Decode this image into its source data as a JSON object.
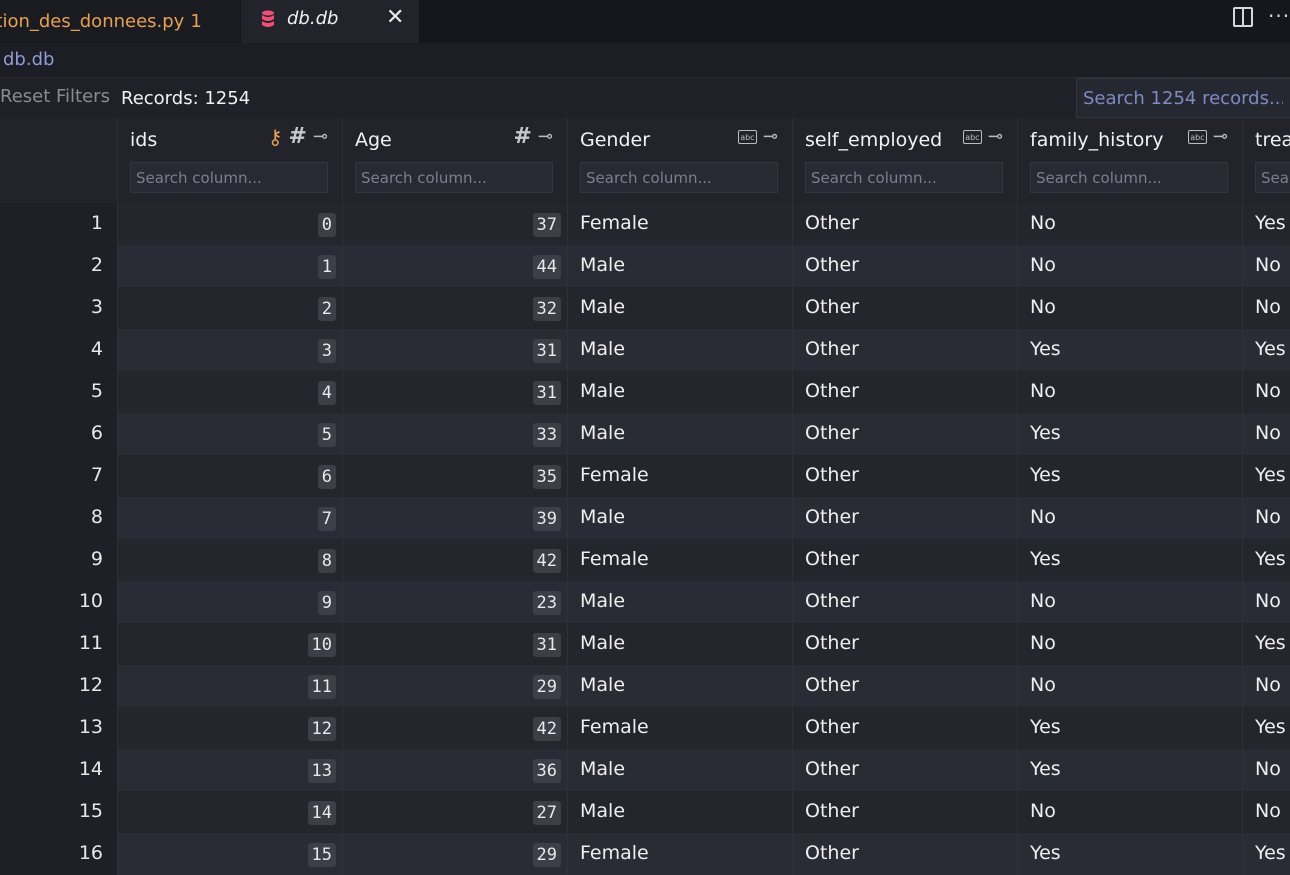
{
  "tabs": [
    {
      "label": "rtion_des_donnees.py",
      "badge": "1"
    },
    {
      "label": "db.db",
      "icon": "database-icon"
    }
  ],
  "breadcrumb": "db.db",
  "toolbar": {
    "reset_label": "Reset Filters",
    "records_label": "Records: 1254",
    "search_placeholder": "Search 1254 records..."
  },
  "columns": [
    {
      "name": "ids",
      "type": "integer",
      "primary_key": true,
      "placeholder": "Search column..."
    },
    {
      "name": "Age",
      "type": "integer",
      "placeholder": "Search column..."
    },
    {
      "name": "Gender",
      "type": "text",
      "placeholder": "Search column..."
    },
    {
      "name": "self_employed",
      "type": "text",
      "placeholder": "Search column..."
    },
    {
      "name": "family_history",
      "type": "text",
      "placeholder": "Search column..."
    },
    {
      "name": "treat",
      "type": "text",
      "placeholder": "Sear"
    }
  ],
  "rows": [
    {
      "n": "1",
      "ids": "0",
      "age": "37",
      "gender": "Female",
      "self_employed": "Other",
      "family_history": "No",
      "treat": "Yes"
    },
    {
      "n": "2",
      "ids": "1",
      "age": "44",
      "gender": "Male",
      "self_employed": "Other",
      "family_history": "No",
      "treat": "No"
    },
    {
      "n": "3",
      "ids": "2",
      "age": "32",
      "gender": "Male",
      "self_employed": "Other",
      "family_history": "No",
      "treat": "No"
    },
    {
      "n": "4",
      "ids": "3",
      "age": "31",
      "gender": "Male",
      "self_employed": "Other",
      "family_history": "Yes",
      "treat": "Yes"
    },
    {
      "n": "5",
      "ids": "4",
      "age": "31",
      "gender": "Male",
      "self_employed": "Other",
      "family_history": "No",
      "treat": "No"
    },
    {
      "n": "6",
      "ids": "5",
      "age": "33",
      "gender": "Male",
      "self_employed": "Other",
      "family_history": "Yes",
      "treat": "No"
    },
    {
      "n": "7",
      "ids": "6",
      "age": "35",
      "gender": "Female",
      "self_employed": "Other",
      "family_history": "Yes",
      "treat": "Yes"
    },
    {
      "n": "8",
      "ids": "7",
      "age": "39",
      "gender": "Male",
      "self_employed": "Other",
      "family_history": "No",
      "treat": "No"
    },
    {
      "n": "9",
      "ids": "8",
      "age": "42",
      "gender": "Female",
      "self_employed": "Other",
      "family_history": "Yes",
      "treat": "Yes"
    },
    {
      "n": "10",
      "ids": "9",
      "age": "23",
      "gender": "Male",
      "self_employed": "Other",
      "family_history": "No",
      "treat": "No"
    },
    {
      "n": "11",
      "ids": "10",
      "age": "31",
      "gender": "Male",
      "self_employed": "Other",
      "family_history": "No",
      "treat": "Yes"
    },
    {
      "n": "12",
      "ids": "11",
      "age": "29",
      "gender": "Male",
      "self_employed": "Other",
      "family_history": "No",
      "treat": "No"
    },
    {
      "n": "13",
      "ids": "12",
      "age": "42",
      "gender": "Female",
      "self_employed": "Other",
      "family_history": "Yes",
      "treat": "Yes"
    },
    {
      "n": "14",
      "ids": "13",
      "age": "36",
      "gender": "Male",
      "self_employed": "Other",
      "family_history": "Yes",
      "treat": "No"
    },
    {
      "n": "15",
      "ids": "14",
      "age": "27",
      "gender": "Male",
      "self_employed": "Other",
      "family_history": "No",
      "treat": "No"
    },
    {
      "n": "16",
      "ids": "15",
      "age": "29",
      "gender": "Female",
      "self_employed": "Other",
      "family_history": "Yes",
      "treat": "Yes"
    }
  ]
}
